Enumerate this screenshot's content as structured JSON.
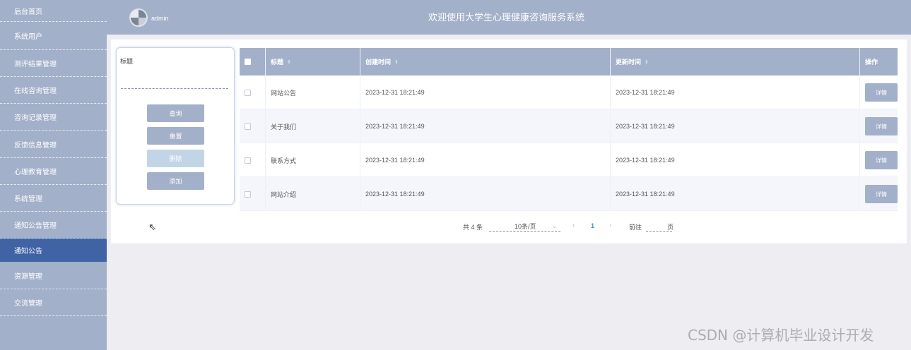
{
  "header": {
    "username": "admin",
    "title": "欢迎使用大学生心理健康咨询服务系统"
  },
  "sidebar": {
    "items": [
      {
        "label": "后台首页",
        "active": false
      },
      {
        "label": "系统用户",
        "active": false
      },
      {
        "label": "测评结果管理",
        "active": false
      },
      {
        "label": "在线咨询管理",
        "active": false
      },
      {
        "label": "咨询记录管理",
        "active": false
      },
      {
        "label": "反馈信息管理",
        "active": false
      },
      {
        "label": "心理教育管理",
        "active": false
      },
      {
        "label": "系统管理",
        "active": false
      },
      {
        "label": "通知公告管理",
        "active": false
      },
      {
        "label": "通知公告",
        "active": true
      },
      {
        "label": "资源管理",
        "active": false
      },
      {
        "label": "交流管理",
        "active": false
      }
    ]
  },
  "search": {
    "label": "标题",
    "placeholder": "",
    "buttons": {
      "query": "查询",
      "reset": "重置",
      "delete": "删除",
      "add": "添加"
    }
  },
  "table": {
    "headers": {
      "title": "标题",
      "created": "创建时间",
      "updated": "更新时间",
      "action": "操作"
    },
    "rows": [
      {
        "title": "网站公告",
        "created": "2023-12-31 18:21:49",
        "updated": "2023-12-31 18:21:49",
        "action": "详情"
      },
      {
        "title": "关于我们",
        "created": "2023-12-31 18:21:49",
        "updated": "2023-12-31 18:21:49",
        "action": "详情"
      },
      {
        "title": "联系方式",
        "created": "2023-12-31 18:21:49",
        "updated": "2023-12-31 18:21:49",
        "action": "详情"
      },
      {
        "title": "网站介绍",
        "created": "2023-12-31 18:21:49",
        "updated": "2023-12-31 18:21:49",
        "action": "详情"
      }
    ]
  },
  "pagination": {
    "total": "共 4 条",
    "page_size": "10条/页",
    "current_page": "1",
    "goto_label": "前往",
    "page_unit": "页"
  },
  "watermark": "CSDN @计算机毕业设计开发",
  "colors": {
    "accent": "#a3b0c9",
    "active": "#3f63a4",
    "page_link": "#3a8ee6",
    "disabled": "#c2d5e6"
  }
}
